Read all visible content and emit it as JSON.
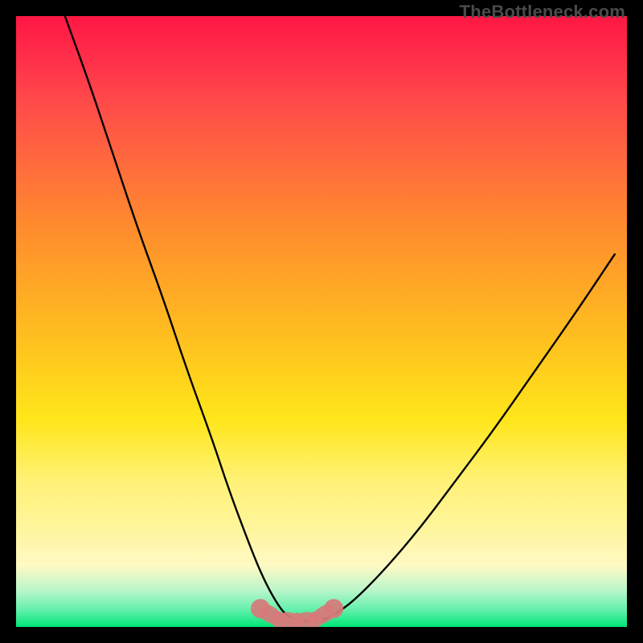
{
  "watermark": "TheBottleneck.com",
  "chart_data": {
    "type": "line",
    "title": "",
    "xlabel": "",
    "ylabel": "",
    "xlim": [
      0,
      100
    ],
    "ylim": [
      0,
      100
    ],
    "series": [
      {
        "name": "bottleneck-curve",
        "x": [
          8,
          12,
          16,
          20,
          24,
          28,
          32,
          35,
          38,
          40,
          42,
          44,
          46,
          48,
          50,
          52,
          55,
          60,
          66,
          72,
          78,
          85,
          92,
          98
        ],
        "values": [
          100,
          89,
          77,
          65,
          54,
          42,
          31,
          22,
          14,
          9,
          5,
          2,
          1,
          1,
          1,
          2,
          4,
          9,
          16,
          24,
          32,
          42,
          52,
          61
        ]
      },
      {
        "name": "marker-blobs",
        "x": [
          40,
          43,
          46,
          49,
          52
        ],
        "values": [
          3,
          1.2,
          1.0,
          1.2,
          3
        ]
      }
    ],
    "background_gradient": {
      "orientation": "vertical",
      "stops": [
        {
          "pos": 0.0,
          "color": "#ff1744"
        },
        {
          "pos": 0.24,
          "color": "#ff6a3d"
        },
        {
          "pos": 0.55,
          "color": "#ffc61e"
        },
        {
          "pos": 0.84,
          "color": "#fff59d"
        },
        {
          "pos": 0.94,
          "color": "#b9f6ca"
        },
        {
          "pos": 1.0,
          "color": "#00e676"
        }
      ]
    }
  }
}
